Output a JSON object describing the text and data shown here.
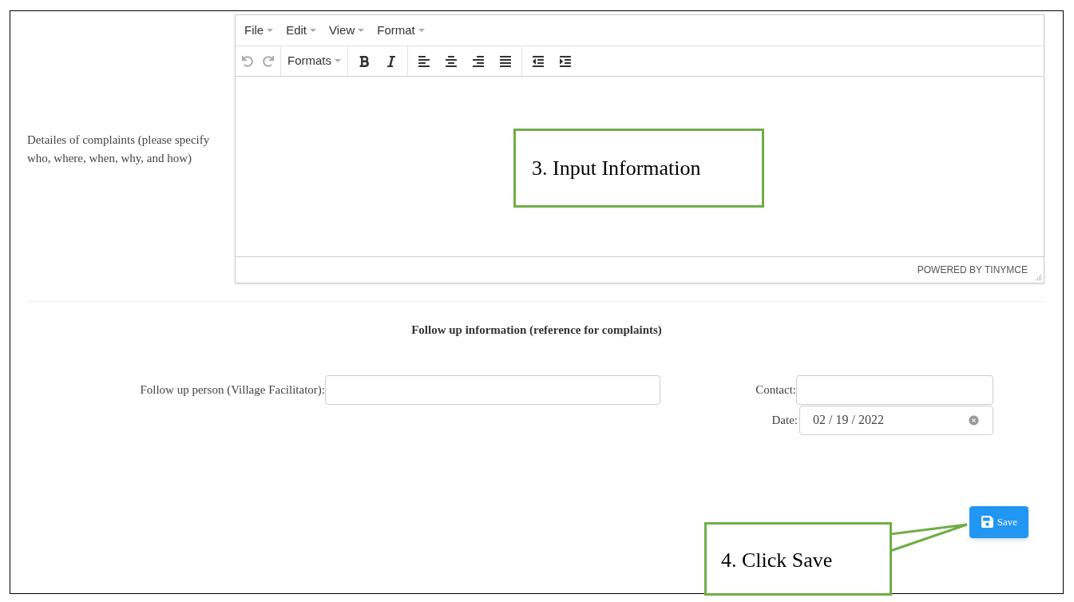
{
  "complaint_details": {
    "label": "Detailes of complaints (please specify who, where, when, why, and how)",
    "editor": {
      "menu": [
        "File",
        "Edit",
        "View",
        "Format"
      ],
      "history": [
        {
          "kind": "undo",
          "disabled": true
        },
        {
          "kind": "redo",
          "disabled": true
        }
      ],
      "formats_label": "Formats",
      "tools": [
        {
          "kind": "bold"
        },
        {
          "kind": "italic"
        },
        {
          "kind": "align-left"
        },
        {
          "kind": "align-center"
        },
        {
          "kind": "align-right"
        },
        {
          "kind": "justify"
        },
        {
          "kind": "outdent"
        },
        {
          "kind": "indent"
        }
      ],
      "footer": "POWERED BY TINYMCE"
    }
  },
  "follow_up": {
    "heading": "Follow up information (reference for complaints)",
    "person_label": "Follow up person (Village Facilitator):",
    "contact_label": "Contact:",
    "date_label": "Date:",
    "date_value": "02 / 19 / 2022"
  },
  "save_button": "Save",
  "callouts": [
    {
      "text": "3.  Input Information"
    },
    {
      "text": "4. Click Save"
    }
  ]
}
